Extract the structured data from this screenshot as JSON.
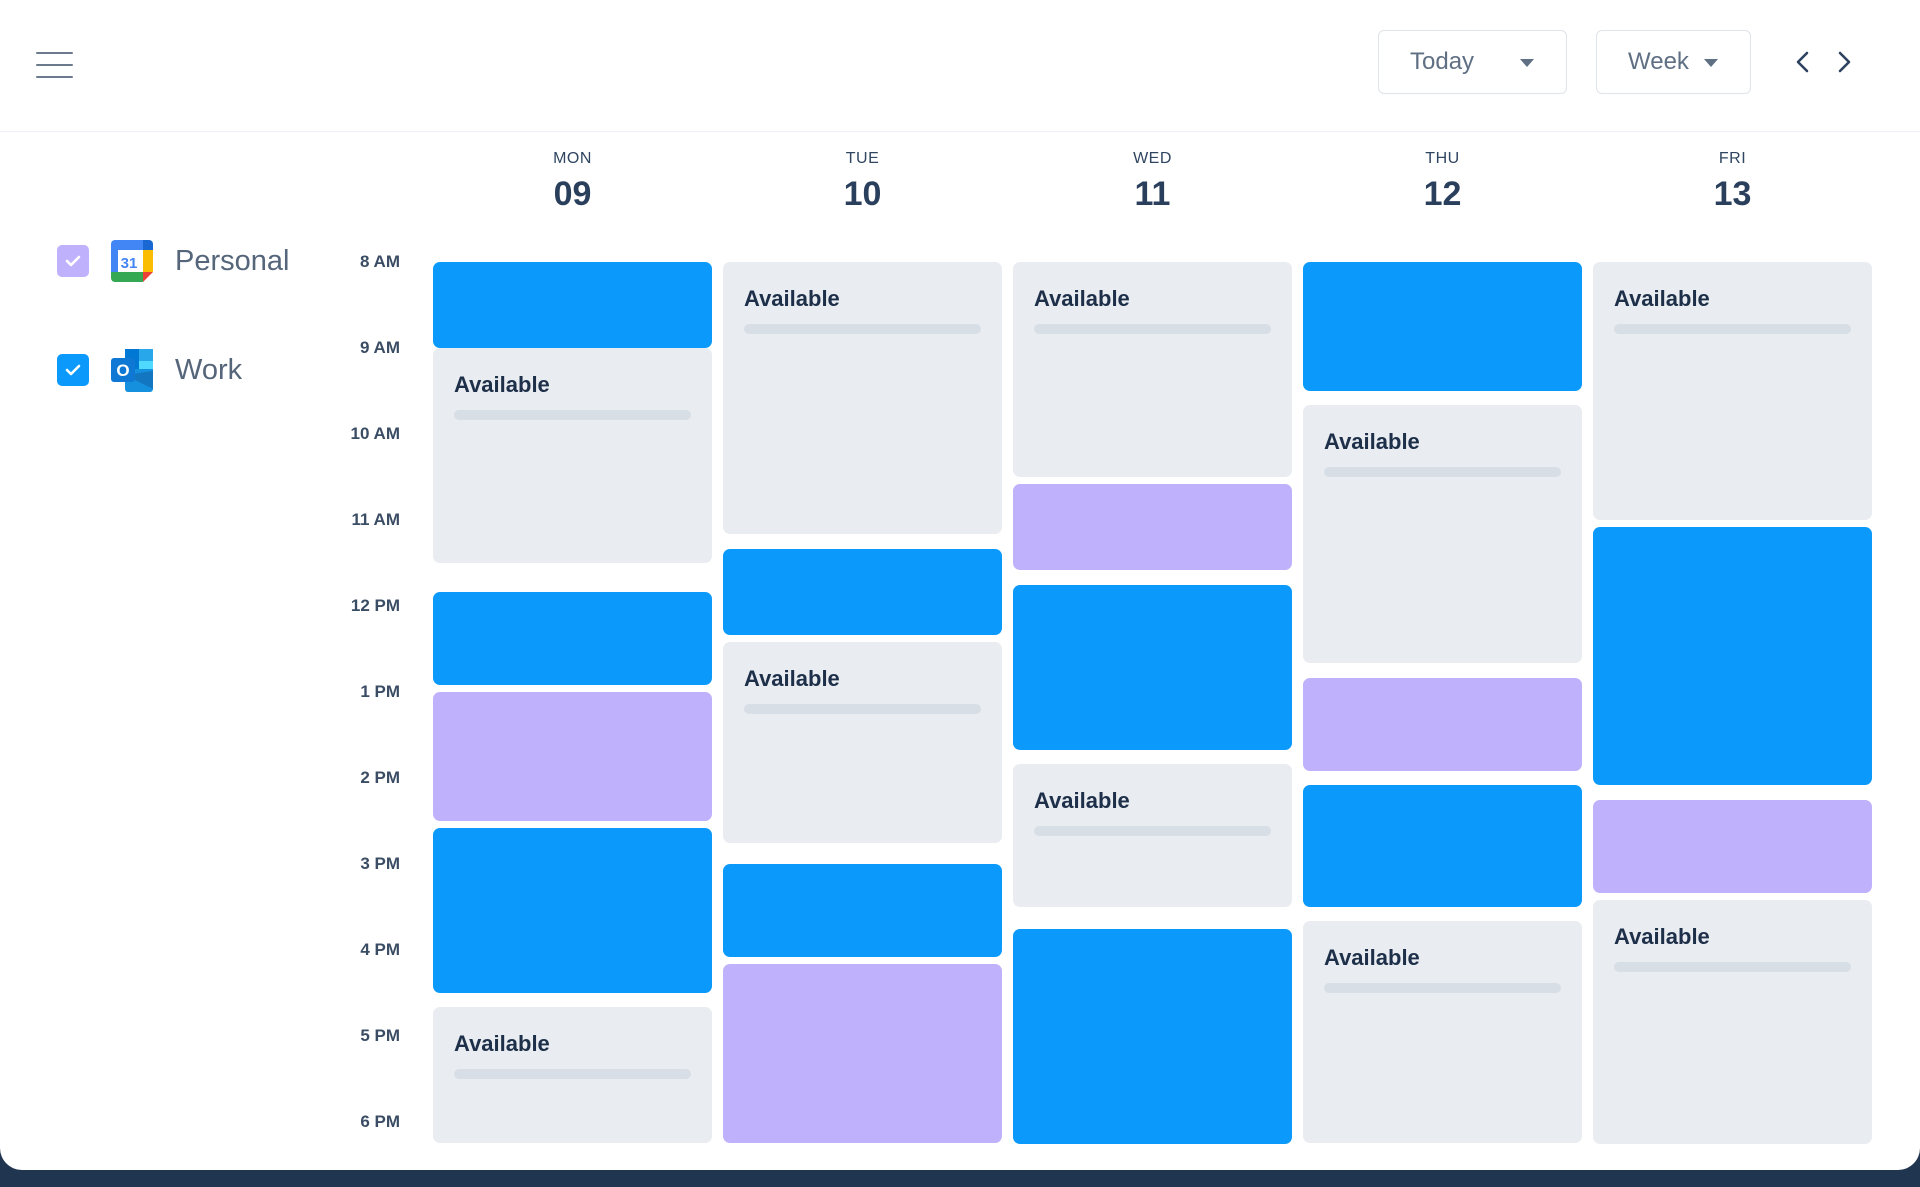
{
  "toolbar": {
    "today_label": "Today",
    "view_label": "Week"
  },
  "calendars": [
    {
      "label": "Personal",
      "checked": true,
      "color": "#c0b1fc",
      "icon": "google-calendar-icon",
      "icon_text": "31"
    },
    {
      "label": "Work",
      "checked": true,
      "color": "#0b9afc",
      "icon": "outlook-icon",
      "icon_text": "O"
    }
  ],
  "times": [
    "8 AM",
    "9 AM",
    "10 AM",
    "11 AM",
    "12 PM",
    "1 PM",
    "2 PM",
    "3 PM",
    "4 PM",
    "5 PM",
    "6 PM"
  ],
  "days": [
    {
      "name": "MON",
      "num": "09"
    },
    {
      "name": "TUE",
      "num": "10"
    },
    {
      "name": "WED",
      "num": "11"
    },
    {
      "name": "THU",
      "num": "12"
    },
    {
      "name": "FRI",
      "num": "13"
    }
  ],
  "available_label": "Available",
  "colors": {
    "work": "#0b9afc",
    "personal": "#c0b1fc",
    "available": "#e9ecf0"
  },
  "events": [
    {
      "day": 0,
      "type": "work",
      "start": "8:00 AM",
      "end": "9:00 AM"
    },
    {
      "day": 0,
      "type": "available",
      "start": "9:00 AM",
      "end": "11:30 AM"
    },
    {
      "day": 0,
      "type": "work",
      "start": "11:50 AM",
      "end": "12:55 PM"
    },
    {
      "day": 0,
      "type": "personal",
      "start": "1:00 PM",
      "end": "2:30 PM"
    },
    {
      "day": 0,
      "type": "work",
      "start": "2:35 PM",
      "end": "4:30 PM"
    },
    {
      "day": 0,
      "type": "available",
      "start": "4:40 PM",
      "end": "6:15 PM"
    },
    {
      "day": 1,
      "type": "available",
      "start": "8:00 AM",
      "end": "11:10 AM"
    },
    {
      "day": 1,
      "type": "work",
      "start": "11:20 AM",
      "end": "12:20 PM"
    },
    {
      "day": 1,
      "type": "available",
      "start": "12:25 PM",
      "end": "2:45 PM"
    },
    {
      "day": 1,
      "type": "work",
      "start": "3:00 PM",
      "end": "4:05 PM"
    },
    {
      "day": 1,
      "type": "personal",
      "start": "4:10 PM",
      "end": "6:15 PM"
    },
    {
      "day": 2,
      "type": "available",
      "start": "8:00 AM",
      "end": "10:30 AM"
    },
    {
      "day": 2,
      "type": "personal",
      "start": "10:35 AM",
      "end": "11:35 AM"
    },
    {
      "day": 2,
      "type": "work",
      "start": "11:45 AM",
      "end": "1:40 PM"
    },
    {
      "day": 2,
      "type": "available",
      "start": "1:50 PM",
      "end": "3:30 PM"
    },
    {
      "day": 2,
      "type": "work",
      "start": "3:45 PM",
      "end": "6:15 PM"
    },
    {
      "day": 3,
      "type": "work",
      "start": "8:00 AM",
      "end": "9:30 AM"
    },
    {
      "day": 3,
      "type": "available",
      "start": "9:40 AM",
      "end": "12:40 PM"
    },
    {
      "day": 3,
      "type": "personal",
      "start": "12:50 PM",
      "end": "1:55 PM"
    },
    {
      "day": 3,
      "type": "work",
      "start": "2:05 PM",
      "end": "3:30 PM"
    },
    {
      "day": 3,
      "type": "available",
      "start": "3:40 PM",
      "end": "6:15 PM"
    },
    {
      "day": 4,
      "type": "available",
      "start": "8:00 AM",
      "end": "11:00 AM"
    },
    {
      "day": 4,
      "type": "work",
      "start": "11:05 AM",
      "end": "2:05 PM"
    },
    {
      "day": 4,
      "type": "personal",
      "start": "2:15 PM",
      "end": "3:20 PM"
    },
    {
      "day": 4,
      "type": "available",
      "start": "3:25 PM",
      "end": "6:15 PM"
    }
  ]
}
